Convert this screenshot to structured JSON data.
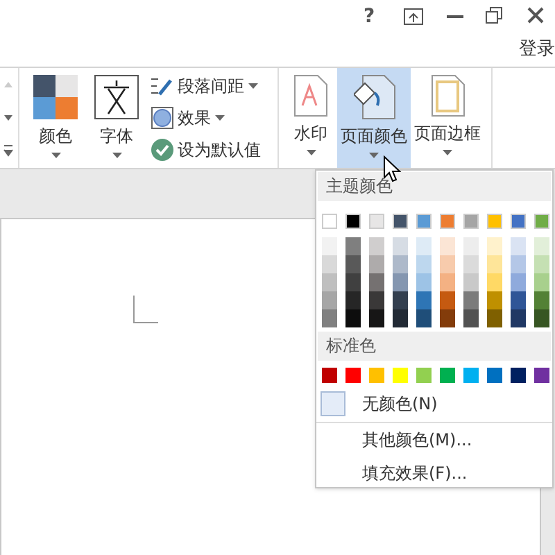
{
  "window_controls": [
    "?",
    "登录"
  ],
  "ribbon": {
    "left_buttons": [
      {
        "label": "颜色",
        "kind": "colors"
      },
      {
        "label": "字体",
        "kind": "fonts"
      }
    ],
    "small_buttons": [
      {
        "label": "段落间距",
        "kind": "spacing",
        "dropdown": true
      },
      {
        "label": "效果",
        "kind": "effects",
        "dropdown": true
      },
      {
        "label": "设为默认值",
        "kind": "default",
        "dropdown": false
      }
    ],
    "background_buttons": [
      {
        "label": "水印",
        "kind": "watermark",
        "selected": false
      },
      {
        "label": "页面颜色",
        "kind": "pagecolor",
        "selected": true
      },
      {
        "label": "页面边框",
        "kind": "border",
        "selected": false
      }
    ]
  },
  "color_menu": {
    "theme_header": "主题颜色",
    "theme_colors": [
      {
        "color": "#ffffff",
        "shades": [
          {
            "color": "#f2f2f2"
          },
          {
            "color": "#d9d9d9"
          },
          {
            "color": "#bfbfbf"
          },
          {
            "color": "#a6a6a6"
          },
          {
            "color": "#808080"
          }
        ]
      },
      {
        "color": "#000000",
        "shades": [
          {
            "color": "#7f7f7f"
          },
          {
            "color": "#595959"
          },
          {
            "color": "#404040"
          },
          {
            "color": "#262626"
          },
          {
            "color": "#0d0d0d"
          }
        ]
      },
      {
        "color": "#e7e6e6",
        "shades": [
          {
            "color": "#d0cece"
          },
          {
            "color": "#aeabab"
          },
          {
            "color": "#757171"
          },
          {
            "color": "#3a3838"
          },
          {
            "color": "#171616"
          }
        ]
      },
      {
        "color": "#44546a",
        "shades": [
          {
            "color": "#d6dce4"
          },
          {
            "color": "#adb9ca"
          },
          {
            "color": "#8496b0"
          },
          {
            "color": "#333f4f"
          },
          {
            "color": "#222a35"
          }
        ]
      },
      {
        "color": "#5b9bd5",
        "shades": [
          {
            "color": "#deebf6"
          },
          {
            "color": "#bdd7ee"
          },
          {
            "color": "#9dc3e6"
          },
          {
            "color": "#2e75b5"
          },
          {
            "color": "#1f4e79"
          }
        ]
      },
      {
        "color": "#ed7d31",
        "shades": [
          {
            "color": "#fbe5d5"
          },
          {
            "color": "#f7cbac"
          },
          {
            "color": "#f4b183"
          },
          {
            "color": "#c55a11"
          },
          {
            "color": "#833c0b"
          }
        ]
      },
      {
        "color": "#a5a5a5",
        "shades": [
          {
            "color": "#ededed"
          },
          {
            "color": "#dbdbdb"
          },
          {
            "color": "#c9c9c9"
          },
          {
            "color": "#7b7b7b"
          },
          {
            "color": "#525252"
          }
        ]
      },
      {
        "color": "#ffc000",
        "shades": [
          {
            "color": "#fff2cc"
          },
          {
            "color": "#fee599"
          },
          {
            "color": "#ffd965"
          },
          {
            "color": "#bf9000"
          },
          {
            "color": "#7f6000"
          }
        ]
      },
      {
        "color": "#4472c4",
        "shades": [
          {
            "color": "#dae3f3"
          },
          {
            "color": "#b4c7e7"
          },
          {
            "color": "#8faadc"
          },
          {
            "color": "#2f5597"
          },
          {
            "color": "#203864"
          }
        ]
      },
      {
        "color": "#70ad47",
        "shades": [
          {
            "color": "#e2efd9"
          },
          {
            "color": "#c5e0b3"
          },
          {
            "color": "#a8d08d"
          },
          {
            "color": "#538135"
          },
          {
            "color": "#375623"
          }
        ]
      }
    ],
    "standard_header": "标准色",
    "standard_colors": [
      {
        "color": "#c00000"
      },
      {
        "color": "#ff0000"
      },
      {
        "color": "#ffc000"
      },
      {
        "color": "#ffff00"
      },
      {
        "color": "#92d050"
      },
      {
        "color": "#00b050"
      },
      {
        "color": "#00b0f0"
      },
      {
        "color": "#0070c0"
      },
      {
        "color": "#002060"
      },
      {
        "color": "#7030a0"
      }
    ],
    "items": [
      {
        "label": "无颜色(N)",
        "kind": "nocolor"
      },
      {
        "label": "其他颜色(M)...",
        "kind": "plain"
      },
      {
        "label": "填充效果(F)...",
        "kind": "plain"
      }
    ]
  }
}
